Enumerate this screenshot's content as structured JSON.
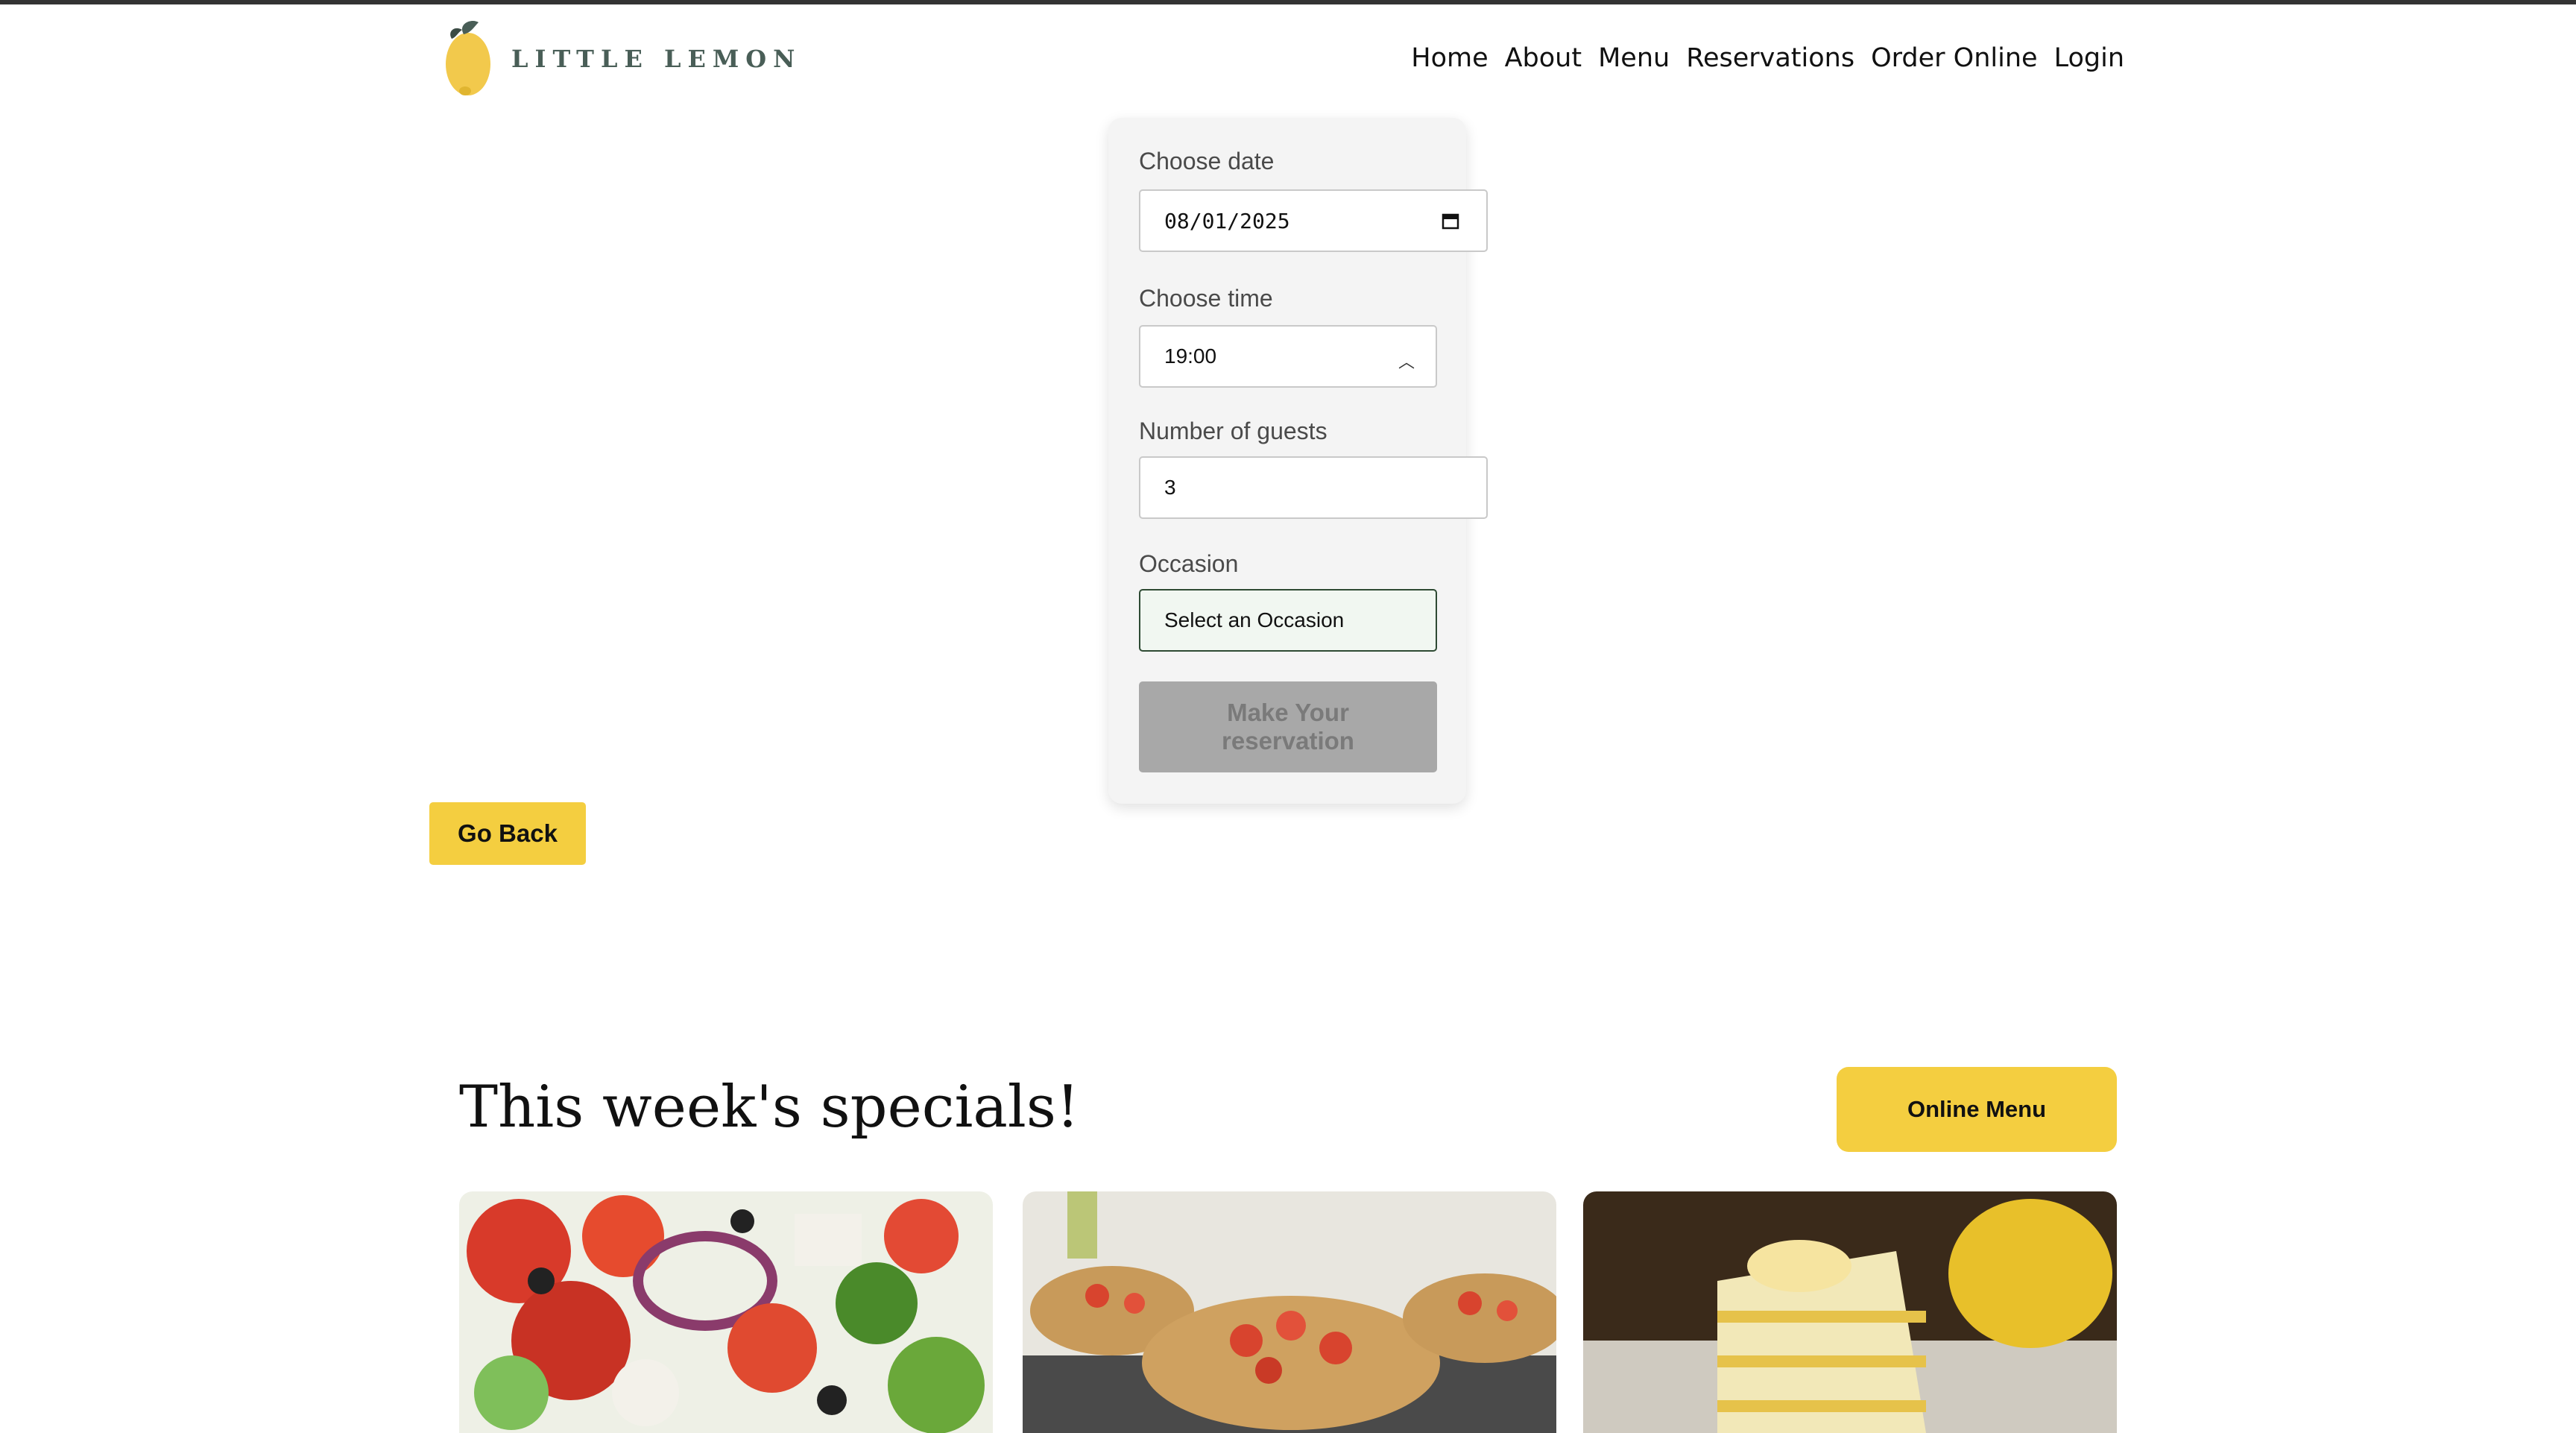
{
  "header": {
    "brand": "LITTLE LEMON",
    "nav": [
      "Home",
      "About",
      "Menu",
      "Reservations",
      "Order Online",
      "Login"
    ]
  },
  "booking": {
    "date_label": "Choose date",
    "date_value": "08/01/2025",
    "time_label": "Choose time",
    "time_value": "19:00",
    "guests_label": "Number of guests",
    "guests_value": "3",
    "occasion_label": "Occasion",
    "occasion_value": "Select an Occasion",
    "submit_label": "Make Your reservation"
  },
  "go_back_label": "Go Back",
  "specials": {
    "title": "This week's specials!",
    "menu_button": "Online Menu",
    "dishes": [
      "greek-salad",
      "bruschetta",
      "lemon-dessert"
    ]
  },
  "colors": {
    "accent_yellow": "#f4ce40",
    "brand_green": "#495e57",
    "disabled_gray": "#a8a8a8"
  }
}
